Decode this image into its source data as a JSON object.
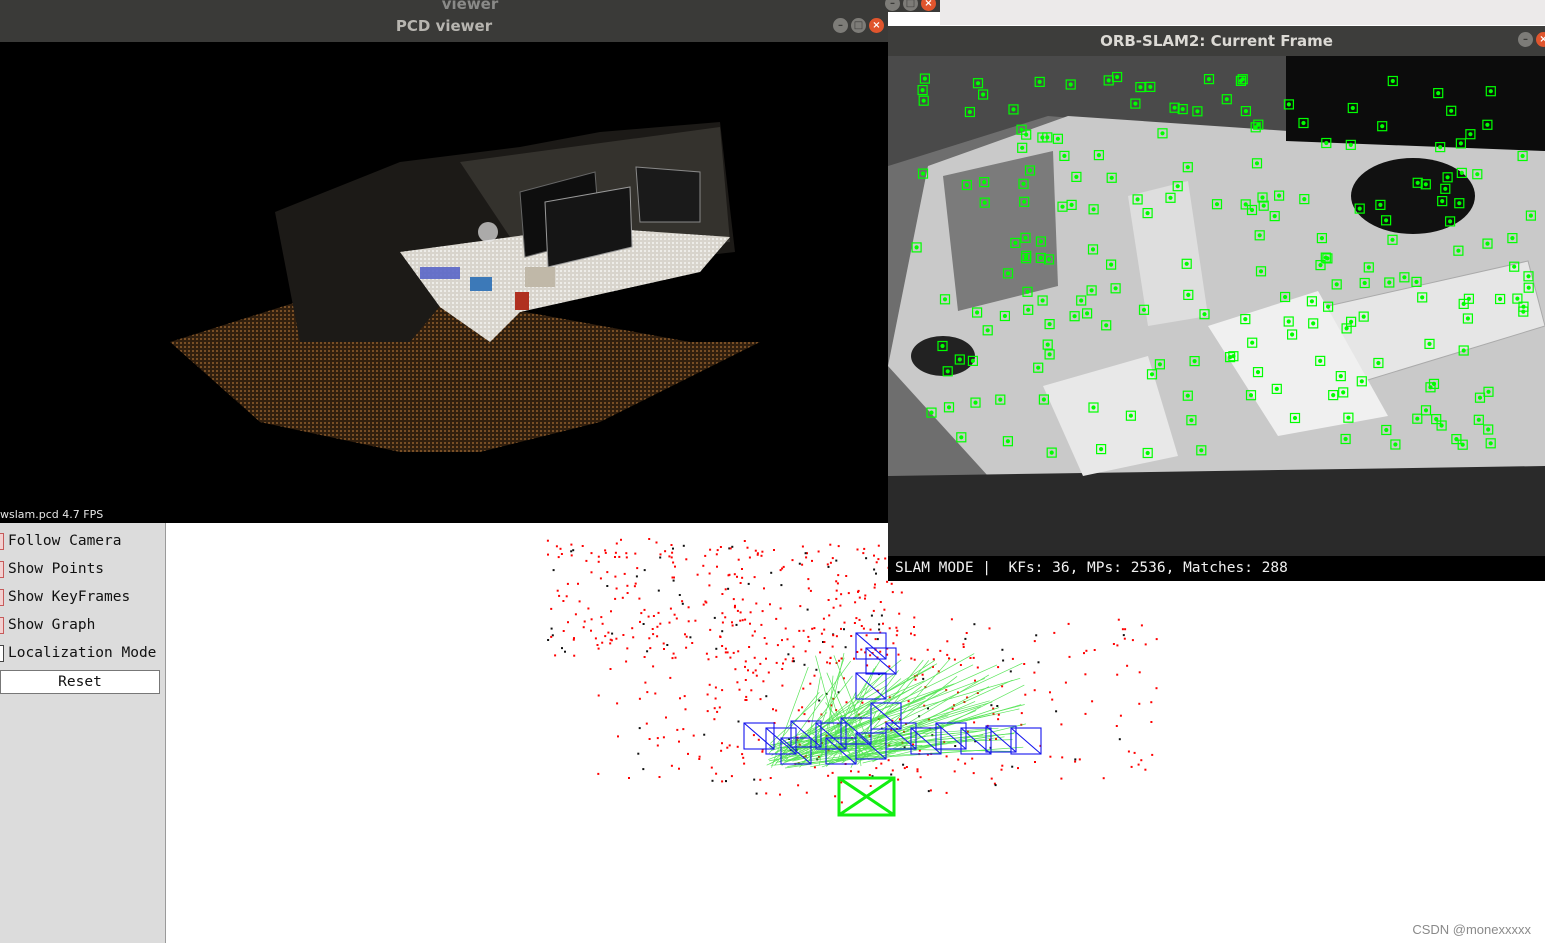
{
  "viewer_window": {
    "title": "viewer"
  },
  "pcd_window": {
    "title": "PCD viewer",
    "caption": "wslam.pcd 4.7 FPS"
  },
  "orb_window": {
    "title": "ORB-SLAM2: Current Frame",
    "status": "SLAM MODE |  KFs: 36, MPs: 2536, Matches: 288"
  },
  "panel": {
    "items": [
      {
        "label": "Follow Camera",
        "checked": true
      },
      {
        "label": "Show Points",
        "checked": true
      },
      {
        "label": "Show KeyFrames",
        "checked": true
      },
      {
        "label": "Show Graph",
        "checked": true
      },
      {
        "label": "Localization Mode",
        "checked": false
      }
    ],
    "reset_label": "Reset"
  },
  "window_controls": {
    "minimize_icon": "minimize-icon",
    "maximize_icon": "maximize-icon",
    "close_icon": "close-icon"
  },
  "colors": {
    "feature_box": "#00ff00",
    "map_point": "#ff0000",
    "keyframe": "#0000ff",
    "current_camera": "#00ee00",
    "covisibility_graph": "#00ff00"
  },
  "watermark": "CSDN @monexxxxx"
}
